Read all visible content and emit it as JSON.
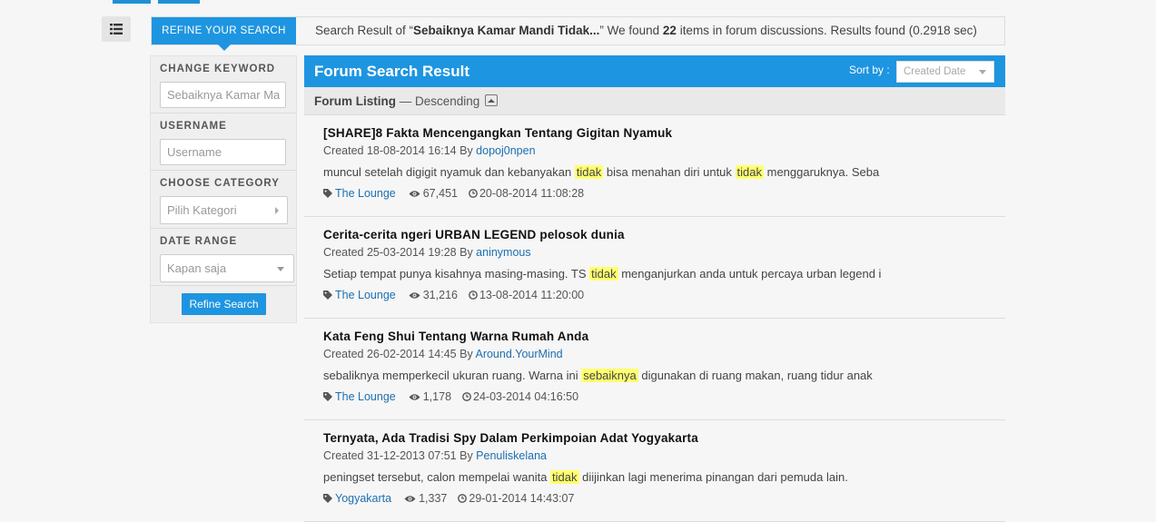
{
  "topbar": {
    "refine_tab": "REFINE YOUR SEARCH",
    "summary_prefix": "Search Result of “",
    "summary_query": "Sebaiknya Kamar Mandi Tidak...",
    "summary_mid": "” We found ",
    "summary_count": "22",
    "summary_suffix": " items in forum discussions. Results found (0.2918 sec)"
  },
  "sidebar": {
    "keyword_label": "CHANGE KEYWORD",
    "keyword_value": "Sebaiknya Kamar Ma",
    "username_label": "USERNAME",
    "username_placeholder": "Username",
    "category_label": "CHOOSE CATEGORY",
    "category_value": "Pilih Kategori",
    "date_label": "DATE RANGE",
    "date_value": "Kapan saja",
    "refine_button": "Refine Search"
  },
  "main": {
    "title": "Forum Search Result",
    "sort_label": "Sort by :",
    "sort_value": "Created Date",
    "listing_label": "Forum Listing",
    "listing_order": " — Descending"
  },
  "results": [
    {
      "title": "[SHARE]8 Fakta Mencengangkan Tentang Gigitan Nyamuk",
      "created": "Created 18-08-2014 16:14 By ",
      "author": "dopoj0npen",
      "snippet": [
        {
          "t": "muncul setelah digigit nyamuk dan kebanyakan "
        },
        {
          "t": "tidak",
          "hl": true
        },
        {
          "t": " bisa menahan diri untuk "
        },
        {
          "t": "tidak",
          "hl": true
        },
        {
          "t": " menggaruknya. Seba"
        }
      ],
      "category": "The Lounge",
      "views": "67,451",
      "last": "20-08-2014 11:08:28"
    },
    {
      "title": "Cerita-cerita ngeri URBAN LEGEND pelosok dunia",
      "created": "Created 25-03-2014 19:28 By ",
      "author": "aninymous",
      "snippet": [
        {
          "t": "Setiap tempat punya kisahnya masing-masing. TS "
        },
        {
          "t": "tidak",
          "hl": true
        },
        {
          "t": " menganjurkan anda untuk percaya urban legend i"
        }
      ],
      "category": "The Lounge",
      "views": "31,216",
      "last": "13-08-2014 11:20:00"
    },
    {
      "title": "Kata Feng Shui Tentang Warna Rumah Anda",
      "created": "Created 26-02-2014 14:45 By ",
      "author": "Around.YourMind",
      "snippet": [
        {
          "t": "sebaliknya memperkecil ukuran ruang. Warna ini "
        },
        {
          "t": "sebaiknya",
          "hl": true
        },
        {
          "t": " digunakan di ruang makan, ruang tidur anak"
        }
      ],
      "category": "The Lounge",
      "views": "1,178",
      "last": "24-03-2014 04:16:50"
    },
    {
      "title": "Ternyata, Ada Tradisi Spy Dalam Perkimpoian Adat Yogyakarta",
      "created": "Created 31-12-2013 07:51 By ",
      "author": "Penuliskelana",
      "snippet": [
        {
          "t": "peningset tersebut, calon mempelai wanita "
        },
        {
          "t": "tidak",
          "hl": true
        },
        {
          "t": " diijinkan lagi menerima pinangan dari pemuda lain."
        }
      ],
      "category": "Yogyakarta",
      "views": "1,337",
      "last": "29-01-2014 14:43:07"
    }
  ],
  "colors": {
    "accent": "#1e95e0",
    "highlight": "#ffff70",
    "link": "#1d6fb0"
  },
  "icons": {
    "menu": "list-icon",
    "tag": "tag-icon",
    "views": "eye-icon",
    "time": "clock-icon",
    "toggle": "chevron-up-icon"
  }
}
